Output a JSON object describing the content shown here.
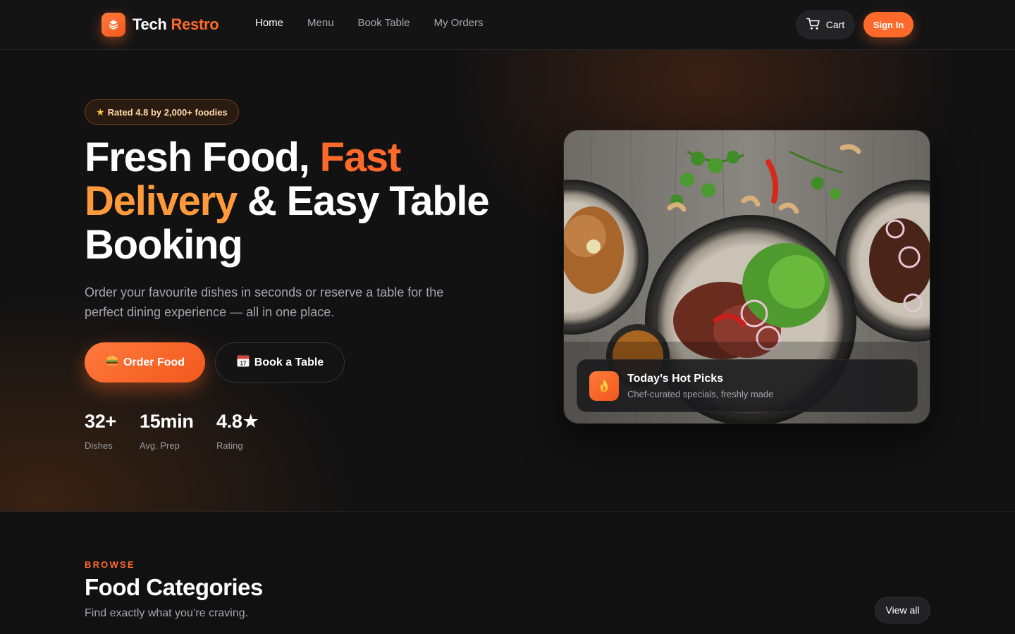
{
  "brand": {
    "name_part1": "Tech",
    "name_part2": "Restro"
  },
  "nav": {
    "links": [
      {
        "label": "Home",
        "active": true
      },
      {
        "label": "Menu",
        "active": false
      },
      {
        "label": "Book Table",
        "active": false
      },
      {
        "label": "My Orders",
        "active": false
      }
    ],
    "cart_label": "Cart",
    "signin_label": "Sign In"
  },
  "hero": {
    "rating_pill": "Rated 4.8 by 2,000+ foodies",
    "headline_1": "Fresh Food, ",
    "headline_2": "Fast",
    "headline_3": "Delivery",
    "headline_4": " & Easy Table Booking",
    "subtitle": "Order your favourite dishes in seconds or reserve a table for the perfect dining experience — all in one place.",
    "order_button": "Order Food",
    "book_button": "Book a Table",
    "stats": [
      {
        "value": "32+",
        "label": "Dishes"
      },
      {
        "value": "15min",
        "label": "Avg. Prep"
      },
      {
        "value": "4.8★",
        "label": "Rating"
      }
    ],
    "hot_picks": {
      "title": "Today’s Hot Picks",
      "subtitle": "Chef-curated specials, freshly made"
    }
  },
  "categories": {
    "eyebrow": "BROWSE",
    "title": "Food Categories",
    "subtitle": "Find exactly what you’re craving.",
    "view_all": "View all"
  },
  "colors": {
    "accent": "#ff6a2b",
    "accent_amber": "#ff9a3c",
    "background": "#111112",
    "surface": "#232326"
  },
  "icons": [
    "logo-layers-icon",
    "cart-icon",
    "star-icon",
    "burger-emoji-icon",
    "calendar-emoji-icon",
    "fire-icon"
  ]
}
